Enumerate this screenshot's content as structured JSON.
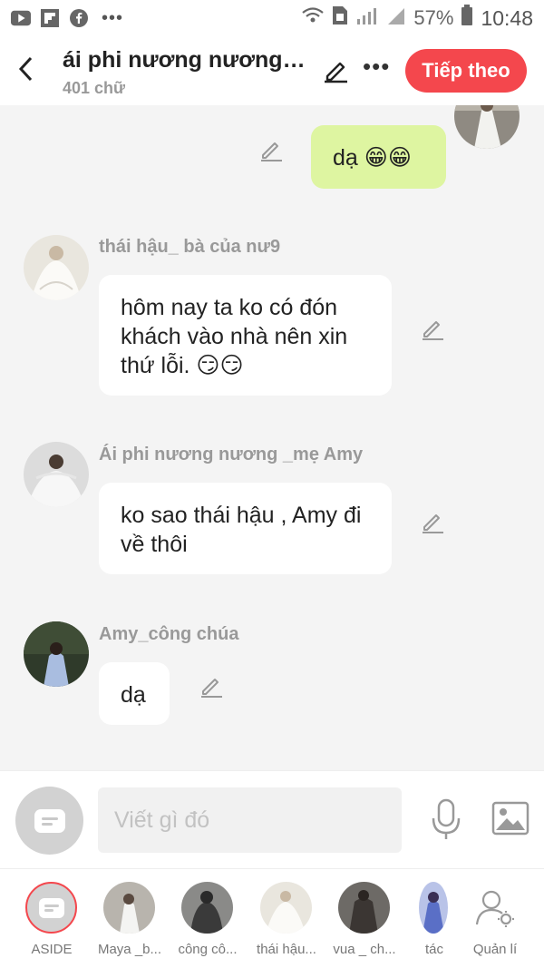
{
  "status_bar": {
    "icons_left": [
      "youtube-icon",
      "flipboard-icon",
      "facebook-icon"
    ],
    "more": "•••",
    "battery": "57%",
    "time": "10:48"
  },
  "header": {
    "title": "ái phi nương nương l...",
    "subtitle": "401 chữ",
    "more": "•••",
    "next_label": "Tiếp theo"
  },
  "messages": [
    {
      "sender": "",
      "text": "dạ 😁😁",
      "mine": true
    },
    {
      "sender": "thái hậu_ bà của nư9",
      "text": "hôm nay ta ko có đón khách vào nhà nên xin thứ lỗi. 😏😏",
      "mine": false
    },
    {
      "sender": "Ái phi nương nương _mẹ Amy",
      "text": "ko sao thái hậu , Amy đi về thôi",
      "mine": false
    },
    {
      "sender": "Amy_công chúa",
      "text": "dạ",
      "mine": false
    }
  ],
  "composer": {
    "placeholder": "Viết gì đó"
  },
  "bottom_nav": [
    {
      "label": "ASIDE",
      "active": true
    },
    {
      "label": "Maya _b..."
    },
    {
      "label": "công cô..."
    },
    {
      "label": "thái hậu..."
    },
    {
      "label": "vua _ ch..."
    },
    {
      "label": "tác"
    },
    {
      "label": "Quản lí"
    }
  ],
  "colors": {
    "accent": "#f4474d",
    "my_bubble": "#def5a1",
    "background": "#f4f4f4"
  }
}
